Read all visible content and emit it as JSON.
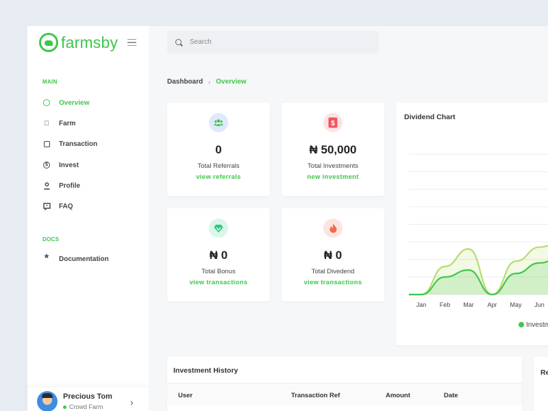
{
  "brand": {
    "name": "farmsby",
    "color": "#3ec74a"
  },
  "sidebar": {
    "sections": [
      {
        "label": "MAIN",
        "items": [
          {
            "label": "Overview",
            "icon": "overview-icon",
            "active": true
          },
          {
            "label": "Farm",
            "icon": "apple-icon"
          },
          {
            "label": "Transaction",
            "icon": "clipboard-icon"
          },
          {
            "label": "Invest",
            "icon": "dollar-circle-icon"
          },
          {
            "label": "Profile",
            "icon": "user-icon"
          },
          {
            "label": "FAQ",
            "icon": "help-chat-icon"
          }
        ]
      },
      {
        "label": "DOCS",
        "items": [
          {
            "label": "Documentation",
            "icon": "asterisk-icon"
          }
        ]
      }
    ],
    "user": {
      "name": "Precious Tom",
      "role": "Crowd Farm"
    }
  },
  "search": {
    "placeholder": "Search"
  },
  "breadcrumb": {
    "root": "Dashboard",
    "current": "Overview"
  },
  "stats": [
    {
      "value": "0",
      "label": "Total Referrals",
      "link": "view referrals",
      "icon": "users-icon",
      "badge_color": "#dfe9fb",
      "icon_color": "#3ec74a"
    },
    {
      "value": "₦ 50,000",
      "label": "Total Investments",
      "link": "new investment",
      "icon": "dollar-note-icon",
      "badge_color": "#fde3e4",
      "icon_color": "#f0565f"
    },
    {
      "value": "₦ 0",
      "label": "Total Bonus",
      "link": "view transactions",
      "icon": "heart-diamond-icon",
      "badge_color": "#d9f7e8",
      "icon_color": "#33c47f"
    },
    {
      "value": "₦ 0",
      "label": "Total Divedend",
      "link": "view transactions",
      "icon": "flame-icon",
      "badge_color": "#fde5df",
      "icon_color": "#f26a4f"
    }
  ],
  "chart_data": {
    "type": "area",
    "title": "Dividend Chart",
    "categories": [
      "Jan",
      "Feb",
      "Mar",
      "Apr",
      "May",
      "Jun"
    ],
    "series": [
      {
        "name": "Investment",
        "color": "#3ec74a",
        "values": [
          0,
          10,
          14,
          0,
          12,
          18
        ]
      },
      {
        "color": "#b5dc6d",
        "values": [
          0,
          16,
          26,
          0,
          19,
          27
        ]
      }
    ],
    "ylim": [
      0,
      80
    ],
    "grid": true,
    "legend": "bottom"
  },
  "history": {
    "title": "Investment History",
    "columns": [
      "User",
      "Transaction Ref",
      "Amount",
      "Date"
    ]
  },
  "right_card": {
    "title": "Re"
  }
}
